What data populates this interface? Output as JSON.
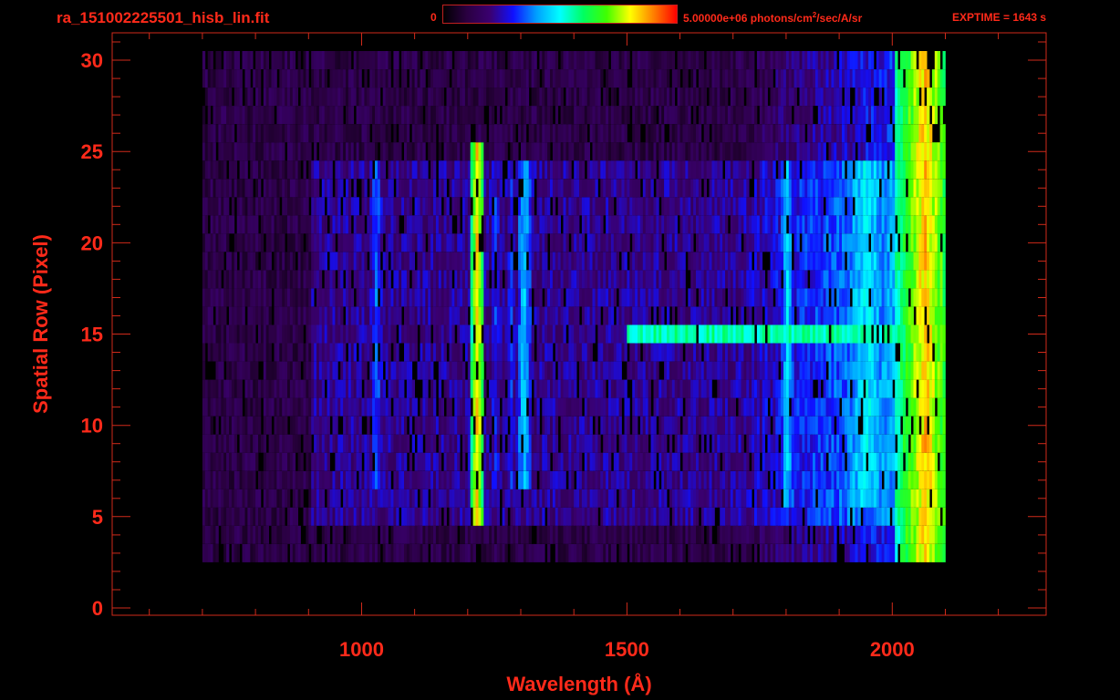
{
  "header": {
    "file_name": "ra_151002225501_hisb_lin.fit",
    "colorbar_min": "0",
    "colorbar_max_value": "5.00000e+06 photons/cm",
    "colorbar_max_exp": "2",
    "colorbar_max_unit": "/sec/A/sr",
    "exptime": "EXPTIME = 1643 s"
  },
  "colors": {
    "label": "#ff2a1a",
    "axes": "#d02a1a",
    "background": "#000000"
  },
  "colorbar": {
    "stops": [
      "#000000",
      "#2a0040",
      "#3a0070",
      "#1010ff",
      "#00a0ff",
      "#00ffff",
      "#00ff60",
      "#40ff00",
      "#ffff00",
      "#ff8000",
      "#ff0000"
    ]
  },
  "chart_data": {
    "type": "heatmap",
    "xlabel": "Wavelength (Å)",
    "ylabel": "Spatial Row (Pixel)",
    "xlim": [
      530,
      2290
    ],
    "ylim": [
      -0.4,
      31.5
    ],
    "x_ticks": [
      1000,
      1500,
      2000
    ],
    "y_ticks": [
      0,
      5,
      10,
      15,
      20,
      25,
      30
    ],
    "x_minor_step": 100,
    "y_minor_step": 1,
    "row_ranges": {
      "bright_rows": [
        5,
        24
      ],
      "detector_rows": [
        3,
        30
      ]
    },
    "wavelength_extent": [
      700,
      2100
    ],
    "emission_lines": [
      {
        "wavelength": 1026,
        "level": 0.35,
        "rows": [
          7,
          24
        ]
      },
      {
        "wavelength": 1216,
        "level": 0.85,
        "rows": [
          5,
          25
        ]
      },
      {
        "wavelength": 1250,
        "level": 0.3,
        "rows": [
          7,
          24
        ]
      },
      {
        "wavelength": 1280,
        "level": 0.3,
        "rows": [
          7,
          24
        ]
      },
      {
        "wavelength": 1304,
        "level": 0.45,
        "rows": [
          7,
          24
        ]
      },
      {
        "wavelength": 1356,
        "level": 0.22,
        "rows": [
          7,
          24
        ]
      },
      {
        "wavelength": 1470,
        "level": 0.22,
        "rows": [
          7,
          24
        ]
      },
      {
        "wavelength": 1800,
        "level": 0.45,
        "rows": [
          6,
          24
        ]
      },
      {
        "wavelength": 1950,
        "level": 0.48,
        "rows": [
          6,
          24
        ]
      },
      {
        "wavelength": 2060,
        "level": 0.85,
        "rows": [
          1,
          30
        ]
      }
    ],
    "continuum_row": {
      "row": 15,
      "wavelength": [
        1500,
        2060
      ],
      "level": 0.55
    }
  }
}
